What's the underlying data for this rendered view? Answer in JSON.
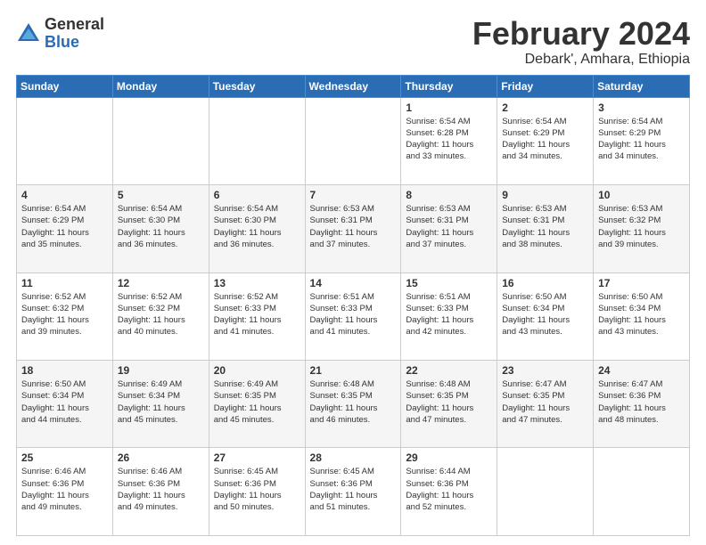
{
  "header": {
    "logo_general": "General",
    "logo_blue": "Blue",
    "title": "February 2024",
    "location": "Debark', Amhara, Ethiopia"
  },
  "days_of_week": [
    "Sunday",
    "Monday",
    "Tuesday",
    "Wednesday",
    "Thursday",
    "Friday",
    "Saturday"
  ],
  "weeks": [
    [
      {
        "num": "",
        "info": ""
      },
      {
        "num": "",
        "info": ""
      },
      {
        "num": "",
        "info": ""
      },
      {
        "num": "",
        "info": ""
      },
      {
        "num": "1",
        "info": "Sunrise: 6:54 AM\nSunset: 6:28 PM\nDaylight: 11 hours\nand 33 minutes."
      },
      {
        "num": "2",
        "info": "Sunrise: 6:54 AM\nSunset: 6:29 PM\nDaylight: 11 hours\nand 34 minutes."
      },
      {
        "num": "3",
        "info": "Sunrise: 6:54 AM\nSunset: 6:29 PM\nDaylight: 11 hours\nand 34 minutes."
      }
    ],
    [
      {
        "num": "4",
        "info": "Sunrise: 6:54 AM\nSunset: 6:29 PM\nDaylight: 11 hours\nand 35 minutes."
      },
      {
        "num": "5",
        "info": "Sunrise: 6:54 AM\nSunset: 6:30 PM\nDaylight: 11 hours\nand 36 minutes."
      },
      {
        "num": "6",
        "info": "Sunrise: 6:54 AM\nSunset: 6:30 PM\nDaylight: 11 hours\nand 36 minutes."
      },
      {
        "num": "7",
        "info": "Sunrise: 6:53 AM\nSunset: 6:31 PM\nDaylight: 11 hours\nand 37 minutes."
      },
      {
        "num": "8",
        "info": "Sunrise: 6:53 AM\nSunset: 6:31 PM\nDaylight: 11 hours\nand 37 minutes."
      },
      {
        "num": "9",
        "info": "Sunrise: 6:53 AM\nSunset: 6:31 PM\nDaylight: 11 hours\nand 38 minutes."
      },
      {
        "num": "10",
        "info": "Sunrise: 6:53 AM\nSunset: 6:32 PM\nDaylight: 11 hours\nand 39 minutes."
      }
    ],
    [
      {
        "num": "11",
        "info": "Sunrise: 6:52 AM\nSunset: 6:32 PM\nDaylight: 11 hours\nand 39 minutes."
      },
      {
        "num": "12",
        "info": "Sunrise: 6:52 AM\nSunset: 6:32 PM\nDaylight: 11 hours\nand 40 minutes."
      },
      {
        "num": "13",
        "info": "Sunrise: 6:52 AM\nSunset: 6:33 PM\nDaylight: 11 hours\nand 41 minutes."
      },
      {
        "num": "14",
        "info": "Sunrise: 6:51 AM\nSunset: 6:33 PM\nDaylight: 11 hours\nand 41 minutes."
      },
      {
        "num": "15",
        "info": "Sunrise: 6:51 AM\nSunset: 6:33 PM\nDaylight: 11 hours\nand 42 minutes."
      },
      {
        "num": "16",
        "info": "Sunrise: 6:50 AM\nSunset: 6:34 PM\nDaylight: 11 hours\nand 43 minutes."
      },
      {
        "num": "17",
        "info": "Sunrise: 6:50 AM\nSunset: 6:34 PM\nDaylight: 11 hours\nand 43 minutes."
      }
    ],
    [
      {
        "num": "18",
        "info": "Sunrise: 6:50 AM\nSunset: 6:34 PM\nDaylight: 11 hours\nand 44 minutes."
      },
      {
        "num": "19",
        "info": "Sunrise: 6:49 AM\nSunset: 6:34 PM\nDaylight: 11 hours\nand 45 minutes."
      },
      {
        "num": "20",
        "info": "Sunrise: 6:49 AM\nSunset: 6:35 PM\nDaylight: 11 hours\nand 45 minutes."
      },
      {
        "num": "21",
        "info": "Sunrise: 6:48 AM\nSunset: 6:35 PM\nDaylight: 11 hours\nand 46 minutes."
      },
      {
        "num": "22",
        "info": "Sunrise: 6:48 AM\nSunset: 6:35 PM\nDaylight: 11 hours\nand 47 minutes."
      },
      {
        "num": "23",
        "info": "Sunrise: 6:47 AM\nSunset: 6:35 PM\nDaylight: 11 hours\nand 47 minutes."
      },
      {
        "num": "24",
        "info": "Sunrise: 6:47 AM\nSunset: 6:36 PM\nDaylight: 11 hours\nand 48 minutes."
      }
    ],
    [
      {
        "num": "25",
        "info": "Sunrise: 6:46 AM\nSunset: 6:36 PM\nDaylight: 11 hours\nand 49 minutes."
      },
      {
        "num": "26",
        "info": "Sunrise: 6:46 AM\nSunset: 6:36 PM\nDaylight: 11 hours\nand 49 minutes."
      },
      {
        "num": "27",
        "info": "Sunrise: 6:45 AM\nSunset: 6:36 PM\nDaylight: 11 hours\nand 50 minutes."
      },
      {
        "num": "28",
        "info": "Sunrise: 6:45 AM\nSunset: 6:36 PM\nDaylight: 11 hours\nand 51 minutes."
      },
      {
        "num": "29",
        "info": "Sunrise: 6:44 AM\nSunset: 6:36 PM\nDaylight: 11 hours\nand 52 minutes."
      },
      {
        "num": "",
        "info": ""
      },
      {
        "num": "",
        "info": ""
      }
    ]
  ]
}
